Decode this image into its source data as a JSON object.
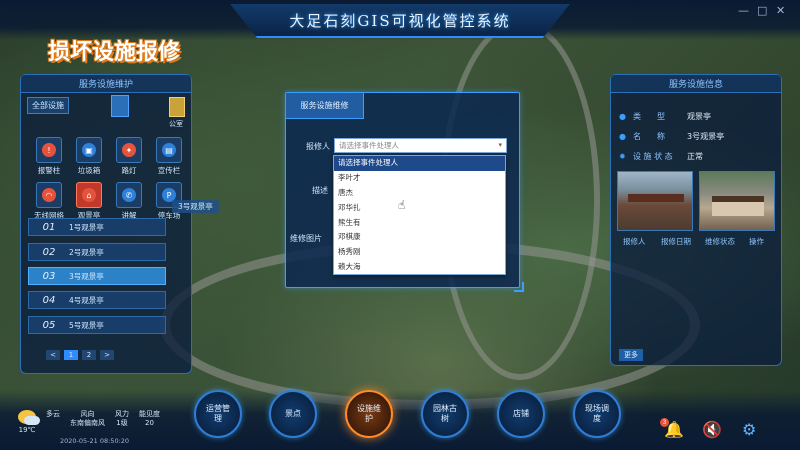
{
  "app": {
    "title": "大足石刻GIS可视化管控系统",
    "page_label": "损坏设施报修",
    "window_controls": [
      "—",
      "□",
      "✕"
    ]
  },
  "left_panel": {
    "title": "服务设施维护",
    "tabs": [
      "全部设施",
      "",
      "",
      "公室"
    ],
    "icons": [
      {
        "label": "报警柱",
        "icon": "alarm-pillar-icon"
      },
      {
        "label": "垃圾箱",
        "icon": "trash-bin-icon"
      },
      {
        "label": "路灯",
        "icon": "streetlight-icon"
      },
      {
        "label": "宣传栏",
        "icon": "bulletin-board-icon"
      },
      {
        "label": "无线网络",
        "icon": "wifi-icon"
      },
      {
        "label": "观景亭",
        "icon": "pavilion-icon"
      },
      {
        "label": "讲解",
        "icon": "phone-icon"
      },
      {
        "label": "停车场",
        "icon": "parking-icon"
      }
    ],
    "hint_chip": "3号观景亭",
    "list": [
      {
        "num": "01",
        "name": "1号观景亭"
      },
      {
        "num": "02",
        "name": "2号观景亭"
      },
      {
        "num": "03",
        "name": "3号观景亭"
      },
      {
        "num": "04",
        "name": "4号观景亭"
      },
      {
        "num": "05",
        "name": "5号观景亭"
      }
    ],
    "pager": [
      "<",
      "1",
      "2",
      ">"
    ]
  },
  "right_panel": {
    "title": "服务设施信息",
    "rows": [
      {
        "key": "类　　型",
        "value": "观景亭"
      },
      {
        "key": "名　　称",
        "value": "3号观景亭"
      },
      {
        "key": "设 施 状 态",
        "value": "正常"
      }
    ],
    "thumb_labels": [
      "报修人",
      "报修日期",
      "维修状态",
      "操作"
    ],
    "more_button": "更多"
  },
  "dialog": {
    "tab": "服务设施维修",
    "labels": {
      "handler": "报修人",
      "description": "描述",
      "photo": "维修图片"
    },
    "select_placeholder": "请选择事件处理人",
    "options": [
      "请选择事件处理人",
      "李叶才",
      "唐杰",
      "邓华扎",
      "熊生有",
      "邓棋康",
      "杨秀刚",
      "赖大海"
    ]
  },
  "bottom": {
    "weather": {
      "condition": "多云",
      "temperature": "19℃",
      "wind_label": "风向",
      "wind_value": "东南偏南风",
      "power_label": "风力",
      "power_value": "1级",
      "visibility_label": "能见度",
      "visibility_value": "20",
      "date": "2020-05-21 08:50:20"
    },
    "nav": [
      {
        "label": "运营管理"
      },
      {
        "label": "景点"
      },
      {
        "label": "设施维护"
      },
      {
        "label": "园林古树"
      },
      {
        "label": "店铺"
      },
      {
        "label": "现场调度"
      }
    ],
    "notification_count": "3"
  },
  "colors": {
    "accent": "#2f8cff",
    "active_nav": "#ff8c2a",
    "alert": "#e5533d",
    "selected_option": "#1e4a8c"
  }
}
